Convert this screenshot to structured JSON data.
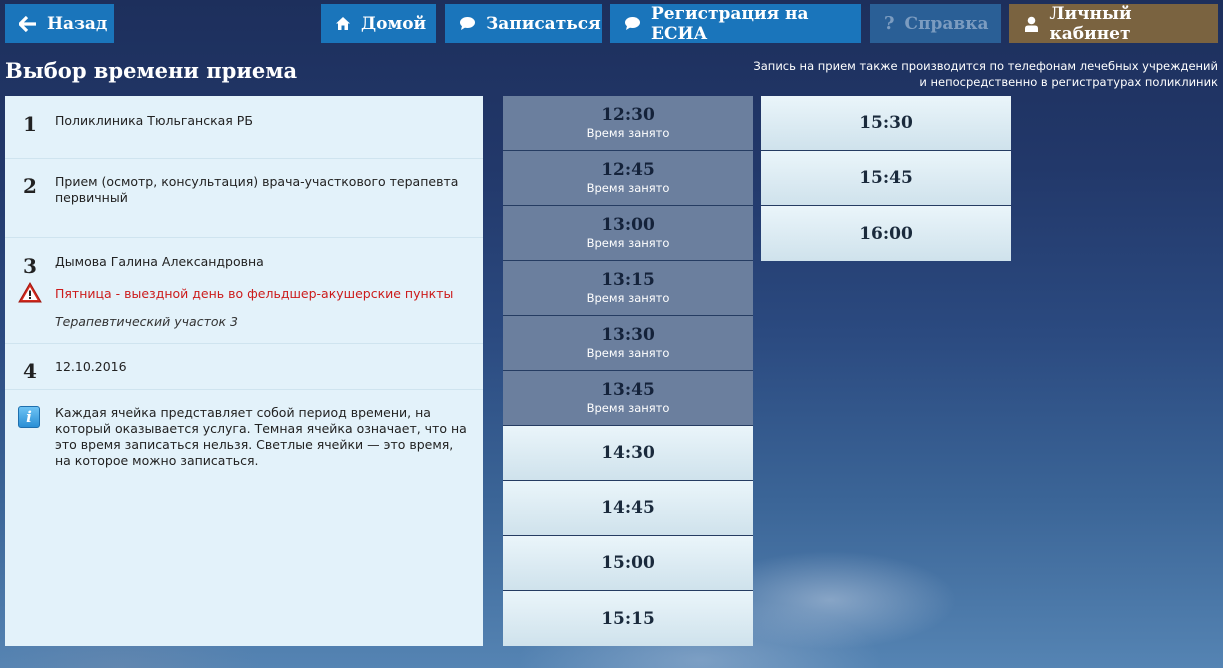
{
  "nav": {
    "back": "Назад",
    "home": "Домой",
    "signup": "Записаться",
    "esia": "Регистрация на ЕСИА",
    "help": "Справка",
    "cabinet": "Личный кабинет"
  },
  "page_title": "Выбор времени приема",
  "notice": {
    "line1": "Запись на прием также производится по телефонам лечебных учреждений",
    "line2": "и непосредственно в регистратурах поликлиник"
  },
  "steps": [
    {
      "num": "1",
      "text": "Поликлиника Тюльганская РБ"
    },
    {
      "num": "2",
      "text": "Прием (осмотр, консультация) врача-участкового терапевта первичный"
    },
    {
      "num": "3",
      "text": "Дымова Галина Александровна",
      "warning": "Пятница - выездной день во фельдшер-акушерские пункты",
      "sub": "Терапевтический участок 3"
    },
    {
      "num": "4",
      "text": "12.10.2016"
    }
  ],
  "info_text": "Каждая ячейка представляет собой период времени, на который оказывается услуга. Темная ячейка означает, что на это время записаться нельзя. Светлые ячейки — это время, на которое можно записаться.",
  "busy_label": "Время занято",
  "slots_col1": [
    {
      "time": "12:30",
      "busy": true
    },
    {
      "time": "12:45",
      "busy": true
    },
    {
      "time": "13:00",
      "busy": true
    },
    {
      "time": "13:15",
      "busy": true
    },
    {
      "time": "13:30",
      "busy": true
    },
    {
      "time": "13:45",
      "busy": true
    },
    {
      "time": "14:30",
      "busy": false
    },
    {
      "time": "14:45",
      "busy": false
    },
    {
      "time": "15:00",
      "busy": false
    },
    {
      "time": "15:15",
      "busy": false
    }
  ],
  "slots_col2": [
    {
      "time": "15:30",
      "busy": false
    },
    {
      "time": "15:45",
      "busy": false
    },
    {
      "time": "16:00",
      "busy": false
    }
  ],
  "colors": {
    "accent": "#1a75bb",
    "cabinet": "#7a6340",
    "warning": "#cc1b1b",
    "busy": "#6b7f9e"
  },
  "icons": {
    "back": "arrow-left-icon",
    "home": "home-icon",
    "signup": "speech-bubble-icon",
    "esia": "speech-bubble-icon",
    "help": "question-icon",
    "cabinet": "user-icon",
    "warning": "warning-triangle-icon",
    "info": "info-icon"
  }
}
